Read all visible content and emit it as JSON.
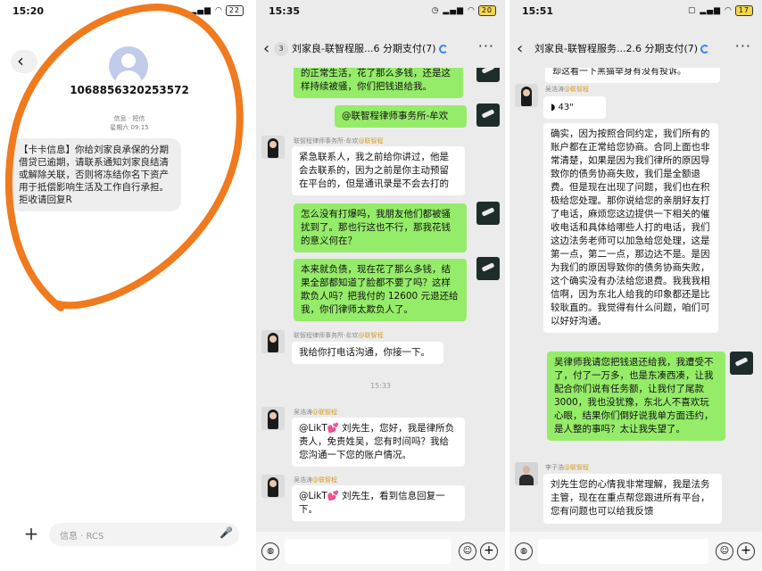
{
  "panel1": {
    "status_time": "15:20",
    "battery": "22",
    "sender": "1068856320253572",
    "meta_line1": "信息 · 短信",
    "meta_line2": "星期六 09:15",
    "sms_text": "【卡卡信息】你给刘家良承保的分期借贷已逾期，请联系通知刘家良结清或解除关联，否则将冻结你名下资产用于抵偿影响生活及工作自行承担。拒收请回复R",
    "input_placeholder": "信息 · RCS",
    "annotation_color": "#f07a1e"
  },
  "panel2": {
    "status_time": "15:35",
    "battery": "20",
    "unread_count": "3",
    "title": "刘家良-联智程服...6 分期支付(7)",
    "messages": [
      {
        "text": "的正常生活，花了那么多钱，还是这样持续被骚，你们把钱退给我。"
      },
      {
        "text": "@联智程律师事务所-牟欢"
      },
      {
        "name": "联智程律师事务所-牟欢",
        "tag": "@联智程",
        "text": "紧急联系人，我之前给你讲过，他是会去联系的，因为之前是你主动预留在平台的，但是通讯录是不会去打的"
      },
      {
        "text": "怎么没有打爆吗，我朋友他们都被骚扰到了。那也行这也不行，那我花钱的意义何在？"
      },
      {
        "text": "本来就负债，现在花了那么多钱，结果全部都知道了脸都不要了吗？这样欺负人吗？把我付的 12600 元退还给我，你们律师太欺负人了。"
      },
      {
        "name": "联智程律师事务所-牟欢",
        "tag": "@联智程",
        "text": "我给你打电话沟通，你接一下。"
      },
      {
        "timestamp": "15:33"
      },
      {
        "name": "吴浩涛",
        "tag": "@联智程",
        "text": "@LikT💕 刘先生，您好，我是律所负责人，免贵姓吴，您有时间吗？我给您沟通一下您的账户情况。"
      },
      {
        "name": "吴浩涛",
        "tag": "@联智程",
        "text": "@LikT💕 刘先生，看到信息回复一下。"
      }
    ]
  },
  "panel3": {
    "status_time": "15:51",
    "battery": "17",
    "title": "刘家良-联智程服务...2.6 分期支付(7)",
    "messages": [
      {
        "text": "却这看一下黑猫举身有没有投诉。"
      },
      {
        "name": "吴浩涛",
        "tag": "@联智程",
        "text": "43\""
      },
      {
        "text": "确实，因为按照合同约定，我们所有的账户都在正常给您协商。合同上面也非常清楚，如果是因为我们律所的原因导致你的债务协商失败，我们是全额退费。但是现在出现了问题，我们也在积极给您处理。那你说给您的亲朋好友打了电话，麻烦您这边提供一下相关的催收电话和具体给哪些人打的电话，我们这边法务老师可以加急给您处理，这是第一点，第二一点，那边达不是。是因为我们的原因导致你的债务协商失败，这个确实没有办法给您退费。我我我相信啊，因为东北人给我的印象都还是比较耿直的。我觉得有什么问题，咱们可以好好沟通。"
      },
      {
        "text": "吴律师我请您把钱退还给我，我遭受不了，付了一万多，也是东凑西凑，让我配合你们说有任务额，让我付了尾款3000，我也没犹豫，东北人不喜欢玩心眼，结果你们倒好说我单方面违约，是人整的事吗？太让我失望了。"
      },
      {
        "name": "李子浩",
        "tag": "@联智程",
        "text": "刘先生您的心情我非常理解，我是法务主管，现在在重点帮您跟进所有平台，您有问题也可以给我反馈"
      }
    ]
  }
}
